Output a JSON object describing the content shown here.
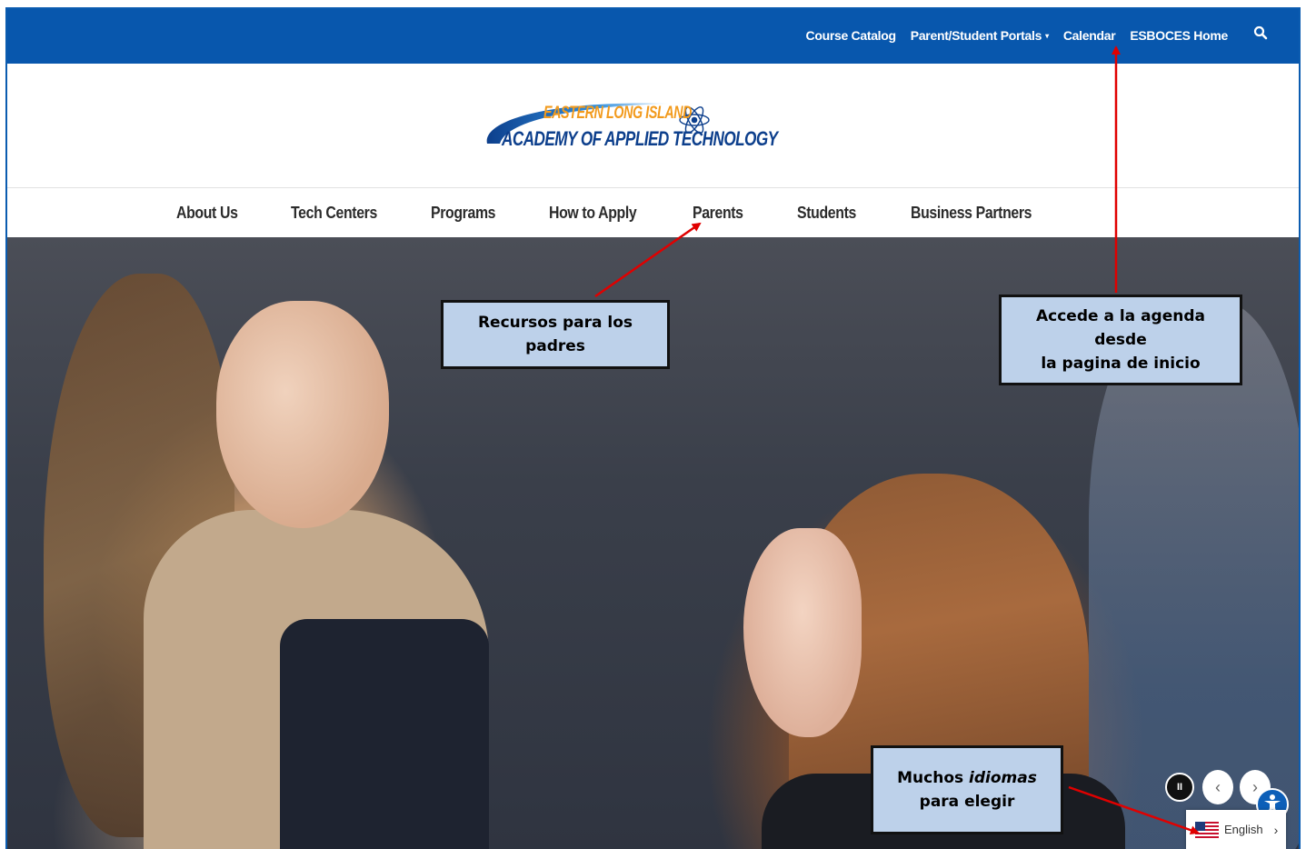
{
  "topbar": {
    "links": [
      "Course Catalog",
      "Parent/Student Portals",
      "Calendar",
      "ESBOCES Home"
    ],
    "portals_caret": "▾"
  },
  "logo": {
    "line1": "EASTERN LONG ISLAND",
    "line2": "ACADEMY OF APPLIED TECHNOLOGY"
  },
  "nav": {
    "items": [
      "About Us",
      "Tech Centers",
      "Programs",
      "How to Apply",
      "Parents",
      "Students",
      "Business Partners"
    ]
  },
  "slider": {
    "pause": "II",
    "prev": "‹",
    "next": "›"
  },
  "language": {
    "label": "English",
    "chevron": "›"
  },
  "annotations": {
    "parents": "Recursos para los padres",
    "calendar_line1": "Accede a la agenda desde",
    "calendar_line2": "la pagina de inicio",
    "lang_part1": "Muchos ",
    "lang_part2": "idiomas",
    "lang_part3": "para elegir"
  },
  "colors": {
    "topbar": "#0857ad",
    "callout_fill": "#bdd1ea",
    "arrow": "#e00000",
    "logo_orange": "#f29a1c",
    "logo_navy": "#0d3f8c"
  },
  "icons": [
    "search-icon",
    "flag-us-icon",
    "accessibility-icon",
    "atom-icon"
  ]
}
